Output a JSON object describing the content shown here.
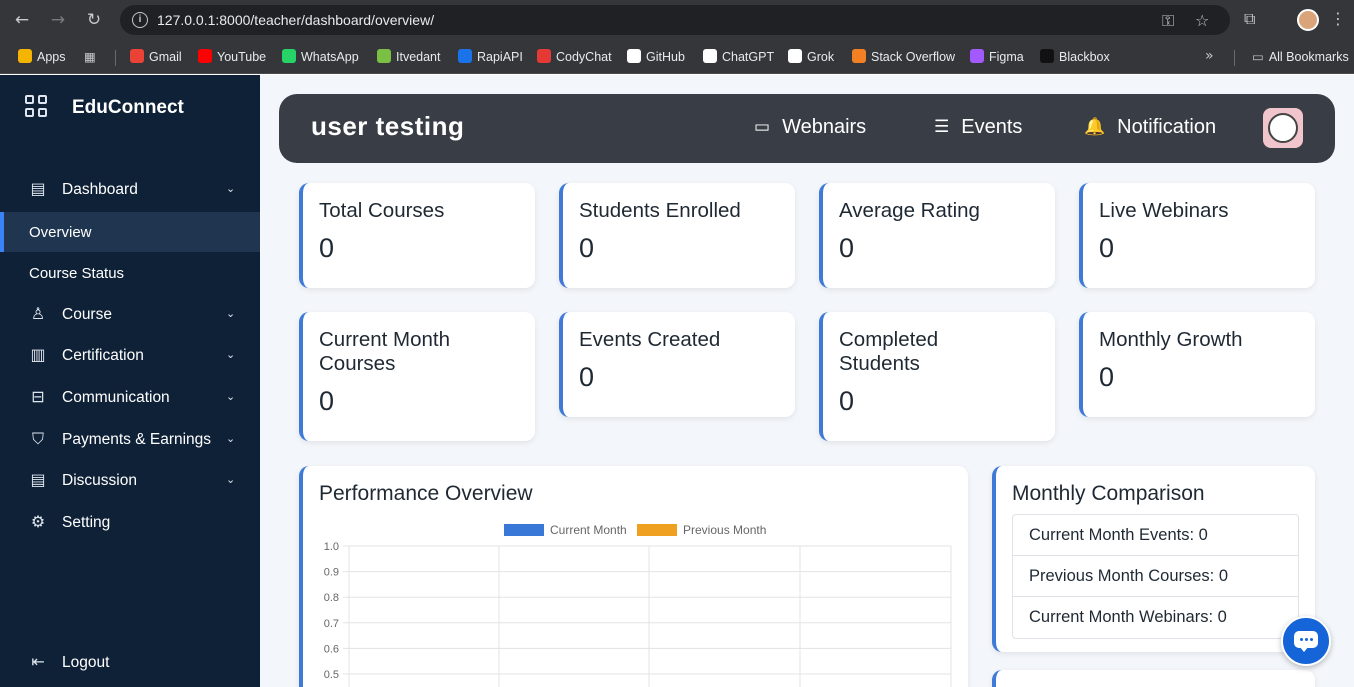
{
  "browser": {
    "url": "127.0.0.1:8000/teacher/dashboard/overview/",
    "bookmarks": [
      {
        "label": "Apps",
        "color": "#f4b400"
      },
      {
        "label": "Gmail",
        "color": "#ea4335"
      },
      {
        "label": "YouTube",
        "color": "#ff0000"
      },
      {
        "label": "WhatsApp",
        "color": "#25d366"
      },
      {
        "label": "Itvedant",
        "color": "#7bc043"
      },
      {
        "label": "RapiAPI",
        "color": "#1a73e8"
      },
      {
        "label": "CodyChat",
        "color": "#e53935"
      },
      {
        "label": "GitHub",
        "color": "#ffffff"
      },
      {
        "label": "ChatGPT",
        "color": "#ffffff"
      },
      {
        "label": "Grok",
        "color": "#ffffff"
      },
      {
        "label": "Stack Overflow",
        "color": "#f48024"
      },
      {
        "label": "Figma",
        "color": "#a259ff"
      },
      {
        "label": "Blackbox",
        "color": "#111111"
      }
    ],
    "all_bookmarks": "All Bookmarks"
  },
  "sidebar": {
    "brand": "EduConnect",
    "items": [
      {
        "label": "Dashboard",
        "icon": "layout-icon",
        "glyph": "▤",
        "chevron": true
      },
      {
        "label": "Overview",
        "sub": true,
        "active": true
      },
      {
        "label": "Course Status",
        "sub": true
      },
      {
        "label": "Course",
        "icon": "user-icon",
        "glyph": "♙",
        "chevron": true
      },
      {
        "label": "Certification",
        "icon": "building-icon",
        "glyph": "▥",
        "chevron": true
      },
      {
        "label": "Communication",
        "icon": "briefcase-icon",
        "glyph": "⊟",
        "chevron": true
      },
      {
        "label": "Payments & Earnings",
        "icon": "shield-icon",
        "glyph": "⛉",
        "chevron": true
      },
      {
        "label": "Discussion",
        "icon": "layout-icon",
        "glyph": "▤",
        "chevron": true
      },
      {
        "label": "Setting",
        "icon": "gear-icon",
        "glyph": "⚙",
        "chevron": false
      }
    ],
    "logout": "Logout"
  },
  "topbar": {
    "title": "user testing",
    "nav": [
      {
        "label": "Webnairs",
        "icon": "video-icon",
        "glyph": "▭"
      },
      {
        "label": "Events",
        "icon": "list-icon",
        "glyph": "☰"
      },
      {
        "label": "Notification",
        "icon": "bell-icon",
        "glyph": "🔔"
      }
    ]
  },
  "stats": [
    {
      "label": "Total Courses",
      "value": "0"
    },
    {
      "label": "Students Enrolled",
      "value": "0"
    },
    {
      "label": "Average Rating",
      "value": "0"
    },
    {
      "label": "Live Webinars",
      "value": "0"
    },
    {
      "label": "Current Month Courses",
      "value": "0"
    },
    {
      "label": "Events Created",
      "value": "0"
    },
    {
      "label": "Completed Students",
      "value": "0"
    },
    {
      "label": "Monthly Growth",
      "value": "0"
    }
  ],
  "performance": {
    "title": "Performance Overview",
    "chart_data": {
      "type": "bar",
      "series": [
        {
          "name": "Current Month",
          "values": [],
          "color": "#3a78d8"
        },
        {
          "name": "Previous Month",
          "values": [],
          "color": "#f0a020"
        }
      ],
      "y_ticks": [
        "1.0",
        "0.9",
        "0.8",
        "0.7",
        "0.6",
        "0.5"
      ],
      "ylim": [
        0,
        1
      ],
      "grid": true
    }
  },
  "comparison": {
    "title": "Monthly Comparison",
    "rows": [
      "Current Month Events: 0",
      "Previous Month Courses: 0",
      "Current Month Webinars: 0"
    ]
  }
}
